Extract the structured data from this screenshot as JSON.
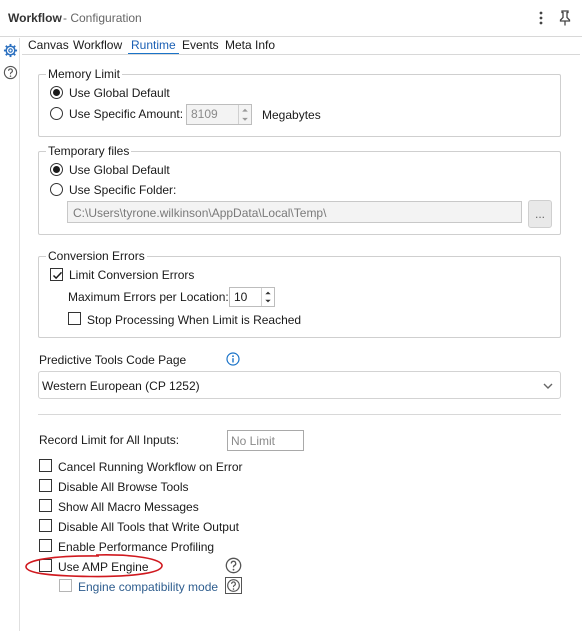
{
  "titlebar": {
    "app": "Workflow",
    "subtitle": "- Configuration"
  },
  "tabs": [
    {
      "label": "Canvas"
    },
    {
      "label": "Workflow"
    },
    {
      "label": "Runtime"
    },
    {
      "label": "Events"
    },
    {
      "label": "Meta Info"
    }
  ],
  "memory": {
    "legend": "Memory Limit",
    "global_label": "Use Global Default",
    "specific_label": "Use Specific Amount:",
    "amount": "8109",
    "unit": "Megabytes"
  },
  "tempfiles": {
    "legend": "Temporary files",
    "global_label": "Use Global Default",
    "folder_label": "Use Specific Folder:",
    "path": "C:\\Users\\tyrone.wilkinson\\AppData\\Local\\Temp\\",
    "browse_label": "..."
  },
  "conversion": {
    "legend": "Conversion Errors",
    "limit_label": "Limit Conversion Errors",
    "max_label": "Maximum Errors per Location:",
    "max_value": "10",
    "stop_label": "Stop Processing When Limit is Reached"
  },
  "codepage": {
    "label": "Predictive Tools Code Page",
    "value": "Western European (CP 1252)"
  },
  "record_limit": {
    "label": "Record Limit for All Inputs:",
    "value": "No Limit"
  },
  "options": [
    {
      "label": "Cancel Running Workflow on Error"
    },
    {
      "label": "Disable All Browse Tools"
    },
    {
      "label": "Show All Macro Messages"
    },
    {
      "label": "Disable All Tools that Write Output"
    },
    {
      "label": "Enable Performance Profiling"
    },
    {
      "label": "Use AMP Engine"
    }
  ],
  "engine_compat": {
    "label": "Engine compatibility mode"
  },
  "colors": {
    "accent": "#1a73c8",
    "annotation": "#d0191f"
  }
}
